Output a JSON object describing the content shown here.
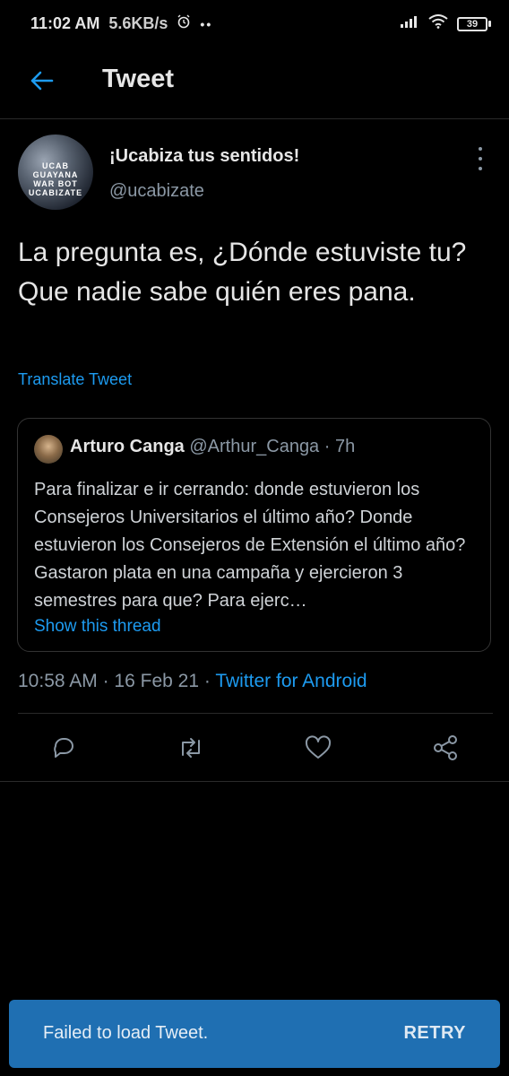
{
  "status_bar": {
    "time": "11:02 AM",
    "speed": "5.6KB/s",
    "battery": "39"
  },
  "header": {
    "title": "Tweet"
  },
  "tweet": {
    "author_name": "¡Ucabiza tus sentidos!",
    "author_handle": "@ucabizate",
    "avatar_text": "UCAB GUAYANA\nWAR BOT\nUCABIZATE",
    "text": "La pregunta es, ¿Dónde estuviste tu?\nQue nadie sabe quién eres pana.",
    "translate_label": "Translate Tweet",
    "time": "10:58 AM",
    "date": "16 Feb 21",
    "source": "Twitter for Android"
  },
  "quoted_tweet": {
    "name": "Arturo Canga",
    "handle": "@Arthur_Canga",
    "age": "7h",
    "text": "Para finalizar e ir cerrando: donde estuvieron los Consejeros Universitarios el último año? Donde estuvieron los Consejeros de Extensión el último año? Gastaron plata en una campaña y ejercieron 3 semestres para que? Para ejerc…",
    "show_thread": "Show this thread"
  },
  "actions": {
    "icons": [
      "reply-icon",
      "retweet-icon",
      "like-icon",
      "share-icon"
    ]
  },
  "snackbar": {
    "message": "Failed to load Tweet.",
    "action": "RETRY"
  },
  "colors": {
    "background": "#000000",
    "link": "#1d9bf0",
    "snackbar": "#1f6fb2"
  }
}
